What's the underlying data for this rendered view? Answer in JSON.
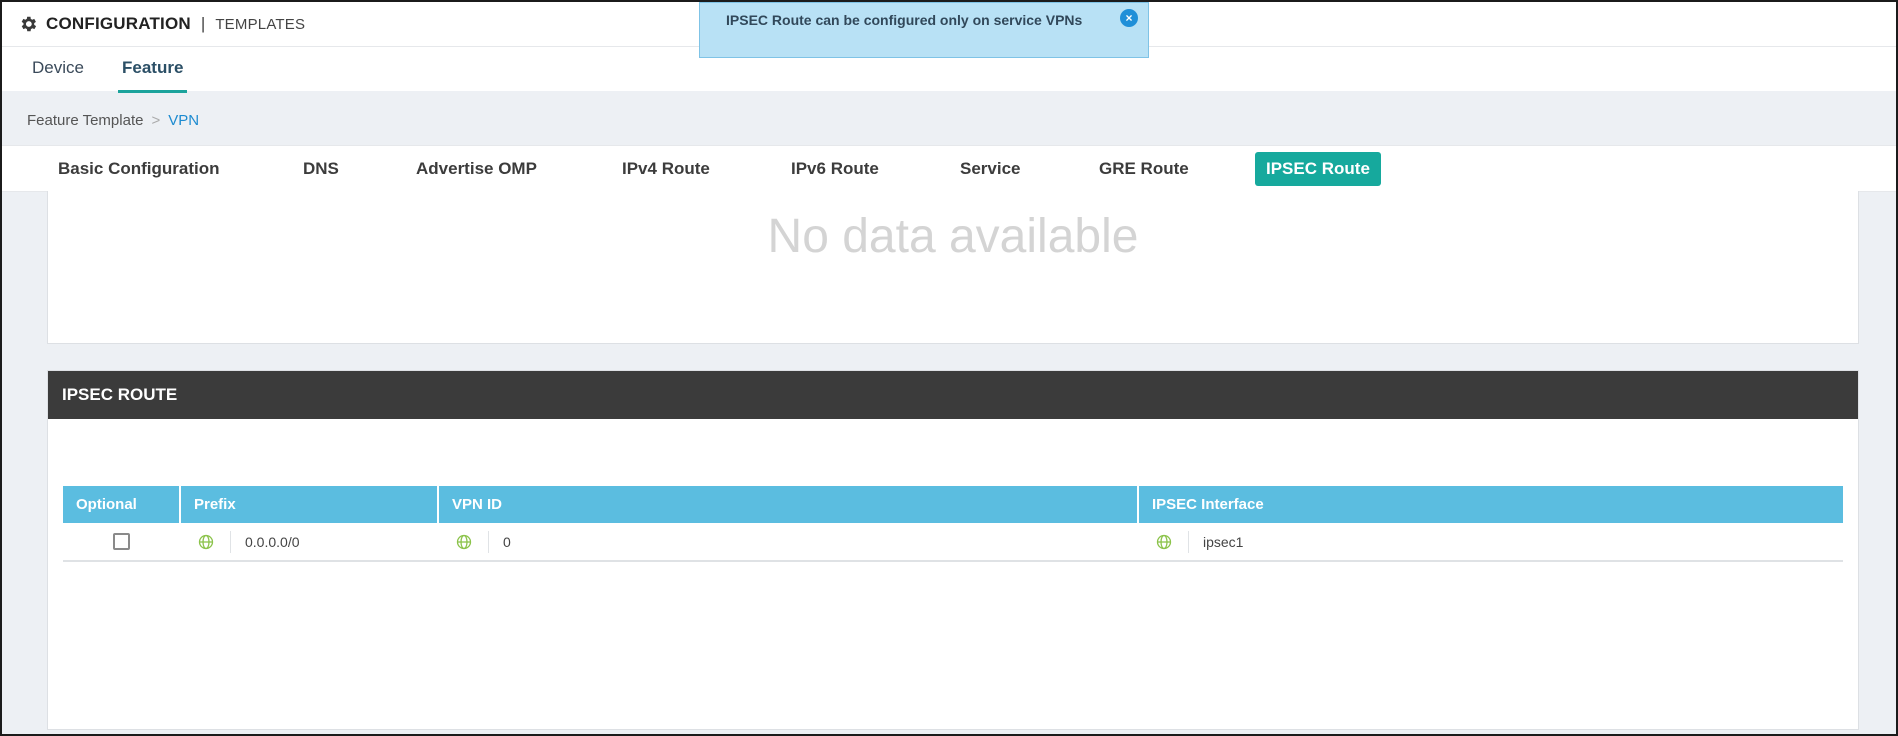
{
  "header": {
    "title_main": "CONFIGURATION",
    "title_sep": "|",
    "title_sub": "TEMPLATES"
  },
  "tabs": [
    {
      "label": "Device",
      "active": false
    },
    {
      "label": "Feature",
      "active": true
    }
  ],
  "toast": {
    "message": "IPSEC Route can be configured only on service VPNs",
    "close_icon": "close-icon"
  },
  "breadcrumb": {
    "parent": "Feature Template",
    "separator": ">",
    "current": "VPN"
  },
  "subtabs": [
    "Basic Configuration",
    "DNS",
    "Advertise OMP",
    "IPv4 Route",
    "IPv6 Route",
    "Service",
    "GRE Route",
    "IPSEC Route"
  ],
  "active_subtab": "IPSEC Route",
  "empty_panel": {
    "text": "No data available"
  },
  "section": {
    "title": "IPSEC ROUTE",
    "columns": [
      "Optional",
      "Prefix",
      "VPN ID",
      "IPSEC Interface"
    ],
    "rows": [
      {
        "optional": false,
        "prefix": "0.0.0.0/0",
        "vpn_id": "0",
        "ipsec_interface": "ipsec1"
      }
    ]
  },
  "colors": {
    "accent": "#16a99d",
    "table_header": "#5bbde0",
    "section_header": "#3b3b3b",
    "toast_bg": "#b8e1f5",
    "link": "#1d8bd0",
    "globe": "#8bc34a"
  }
}
